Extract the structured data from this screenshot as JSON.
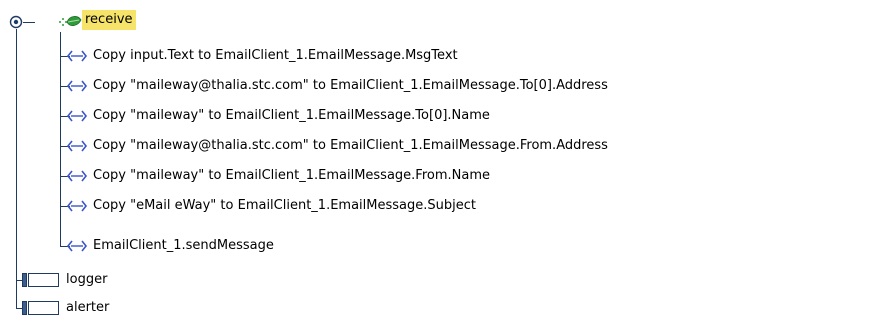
{
  "tree": {
    "root": {
      "label": "receive",
      "expanded": true,
      "icon": "leaf-branch-icon",
      "highlight_color": "#f6e36a"
    },
    "children": [
      {
        "text": "Copy input.Text to EmailClient_1.EmailMessage.MsgText",
        "icon": "copy-arrow-icon"
      },
      {
        "text": "Copy \"maileway@thalia.stc.com\" to EmailClient_1.EmailMessage.To[0].Address",
        "icon": "copy-arrow-icon"
      },
      {
        "text": "Copy \"maileway\" to EmailClient_1.EmailMessage.To[0].Name",
        "icon": "copy-arrow-icon"
      },
      {
        "text": "Copy \"maileway@thalia.stc.com\" to EmailClient_1.EmailMessage.From.Address",
        "icon": "copy-arrow-icon"
      },
      {
        "text": "Copy \"maileway\" to EmailClient_1.EmailMessage.From.Name",
        "icon": "copy-arrow-icon"
      },
      {
        "text": "Copy \"eMail eWay\" to EmailClient_1.EmailMessage.Subject",
        "icon": "copy-arrow-icon"
      },
      {
        "text": "EmailClient_1.sendMessage",
        "icon": "method-arrow-icon"
      }
    ],
    "siblings": [
      {
        "text": "logger",
        "icon": "component-box-icon"
      },
      {
        "text": "alerter",
        "icon": "component-box-icon"
      }
    ],
    "colors": {
      "line": "#1f3a63",
      "arrow": "#3b55c9",
      "leaf_green": "#2f9a3c"
    }
  }
}
